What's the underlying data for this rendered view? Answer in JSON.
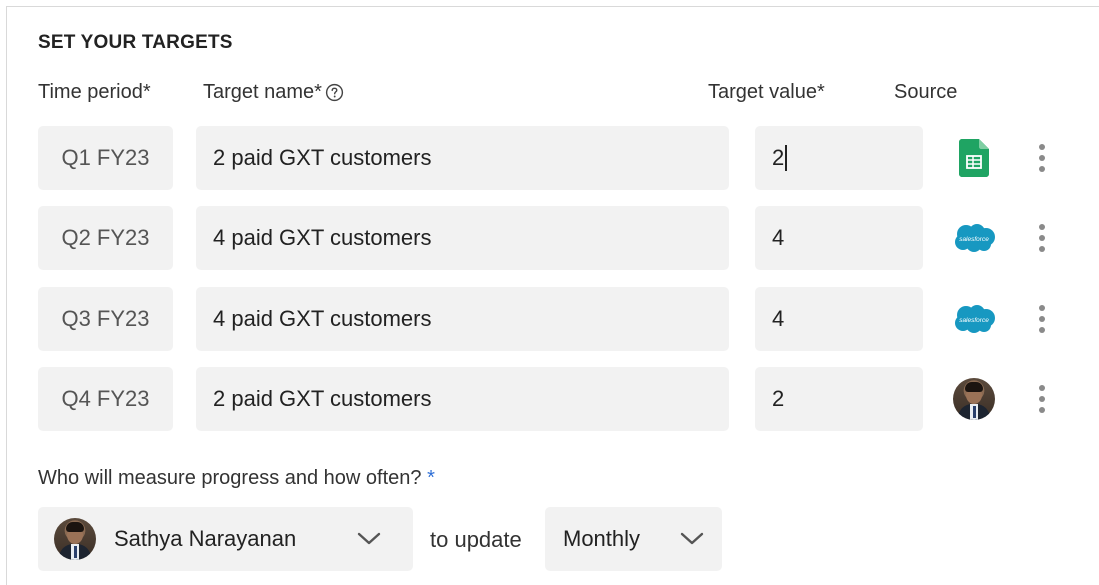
{
  "section_title": "SET YOUR TARGETS",
  "columns": {
    "time_period": "Time period*",
    "target_name": "Target name*",
    "target_value": "Target value*",
    "source": "Source"
  },
  "rows": [
    {
      "period": "Q1 FY23",
      "name": "2 paid GXT customers",
      "value": "2",
      "source_icon": "google-sheets-icon"
    },
    {
      "period": "Q2 FY23",
      "name": "4 paid GXT customers",
      "value": "4",
      "source_icon": "salesforce-icon"
    },
    {
      "period": "Q3 FY23",
      "name": "4 paid GXT customers",
      "value": "4",
      "source_icon": "salesforce-icon"
    },
    {
      "period": "Q4 FY23",
      "name": "2 paid GXT customers",
      "value": "2",
      "source_icon": "user-avatar"
    }
  ],
  "measure": {
    "question": "Who will measure progress and how often?",
    "required_mark": "*",
    "owner": "Sathya Narayanan",
    "connector": "to update",
    "frequency": "Monthly"
  },
  "salesforce_label": "salesforce",
  "colors": {
    "field_bg": "#f2f2f2",
    "sheets_green": "#1fa463",
    "salesforce_blue": "#1798c1",
    "required_blue": "#2f6fd6",
    "kebab_gray": "#8a8a8a"
  }
}
